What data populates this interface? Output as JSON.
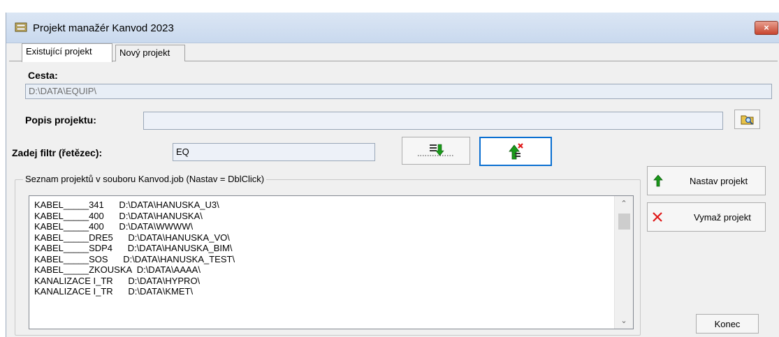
{
  "window": {
    "title": "Projekt manažér Kanvod 2023",
    "close_label": "×"
  },
  "tabs": [
    {
      "label": "Existující projekt",
      "active": true
    },
    {
      "label": "Nový projekt",
      "active": false
    }
  ],
  "path": {
    "label": "Cesta:",
    "value": "D:\\DATA\\EQUIP\\"
  },
  "description": {
    "label": "Popis projektu:",
    "value": ""
  },
  "filter": {
    "label": "Zadej filtr (řetězec):",
    "value": "EQ"
  },
  "list_group": {
    "legend": "Seznam projektů v souboru Kanvod.job (Nastav = DblClick)",
    "items": [
      "KABEL_____341      D:\\DATA\\HANUSKA_U3\\",
      "KABEL_____400      D:\\DATA\\HANUSKA\\",
      "KABEL_____400      D:\\DATA\\WWWW\\",
      "KABEL_____DRE5      D:\\DATA\\HANUSKA_VO\\",
      "KABEL_____SDP4      D:\\DATA\\HANUSKA_BIM\\",
      "KABEL_____SOS      D:\\DATA\\HANUSKA_TEST\\",
      "KABEL_____ZKOUSKA  D:\\DATA\\AAAA\\",
      "KANALIZACE I_TR      D:\\DATA\\HYPRO\\",
      "KANALIZACE I_TR      D:\\DATA\\KMET\\"
    ]
  },
  "buttons": {
    "set_project": "Nastav projekt",
    "delete_project": "Vymaž projekt",
    "close": "Konec"
  },
  "colors": {
    "focus_border": "#0a6fd1",
    "arrow_green": "#1a9a1a",
    "cross_red": "#e01818"
  },
  "icons": {
    "app": "database-icon",
    "browse": "folder-search-icon",
    "insert": "insert-down-arrow-icon",
    "remove": "remove-entry-icon"
  }
}
